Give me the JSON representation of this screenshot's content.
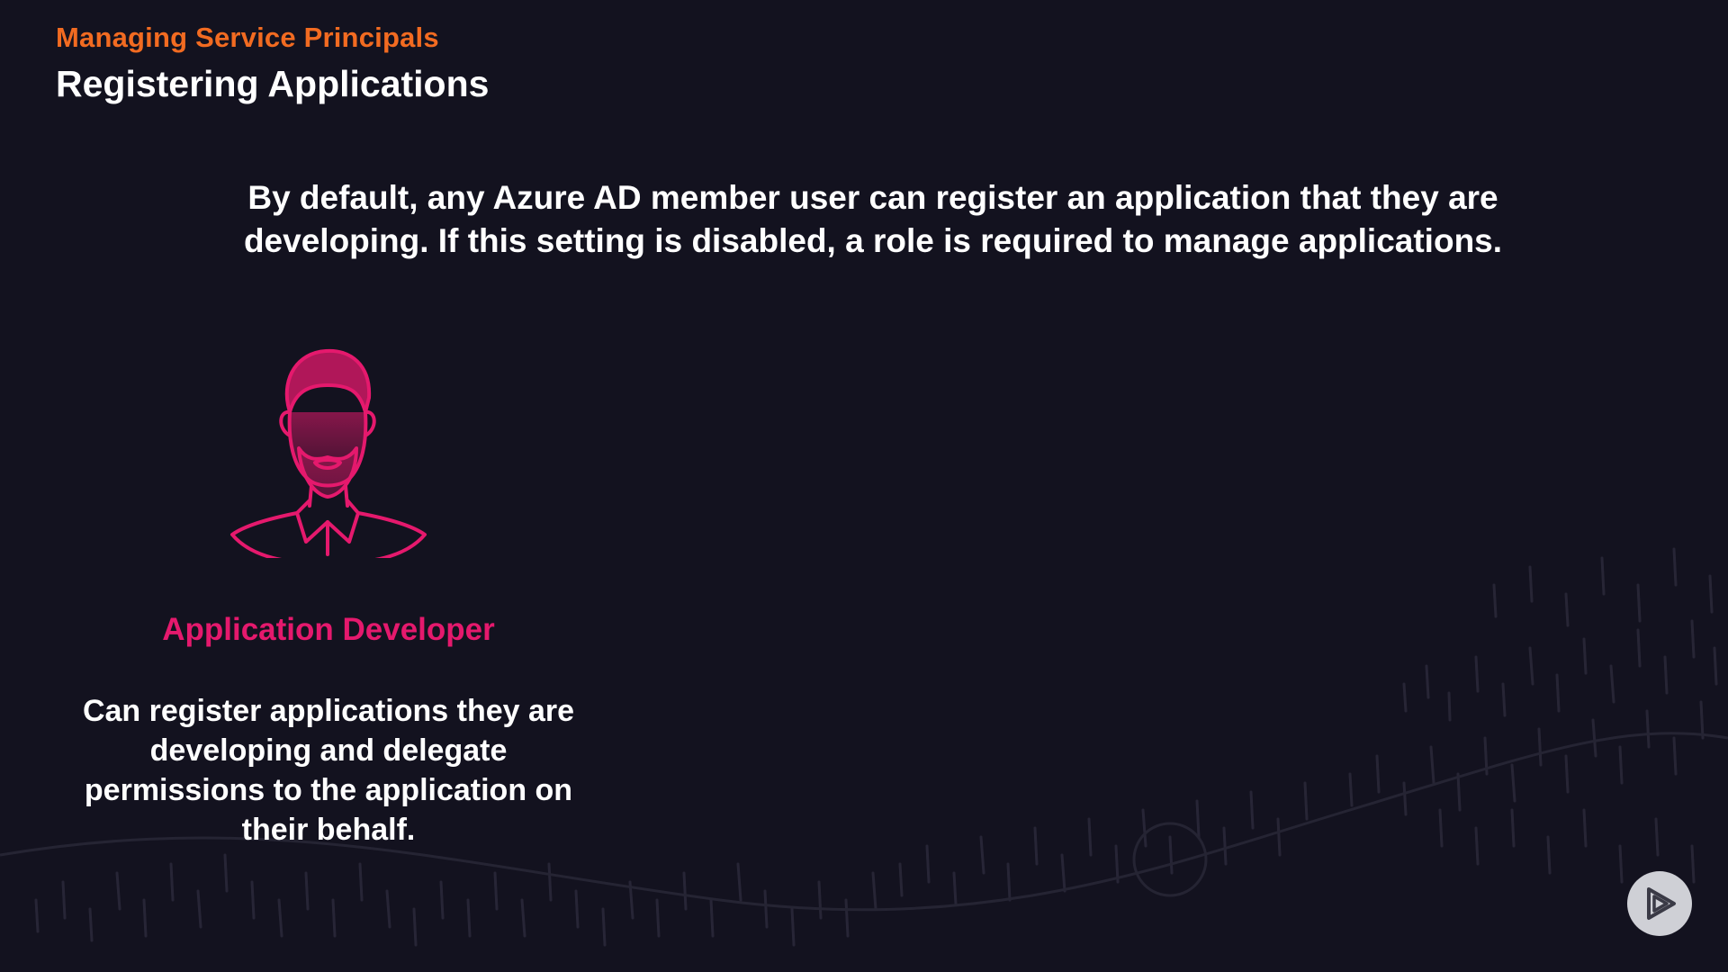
{
  "header": {
    "module_title": "Managing Service Principals",
    "slide_title": "Registering Applications"
  },
  "intro_text": "By default, any Azure AD member user can register an application that they are developing. If this setting is disabled, a role is required to manage applications.",
  "role": {
    "icon": "developer-person-icon",
    "name": "Application Developer",
    "description": "Can register applications they are developing and delegate permissions to the application on their behalf."
  },
  "controls": {
    "play_icon": "play-logo-icon"
  },
  "colors": {
    "background": "#13121f",
    "module_title": "#f26b21",
    "accent_pink": "#e5196d",
    "text": "#ffffff"
  }
}
